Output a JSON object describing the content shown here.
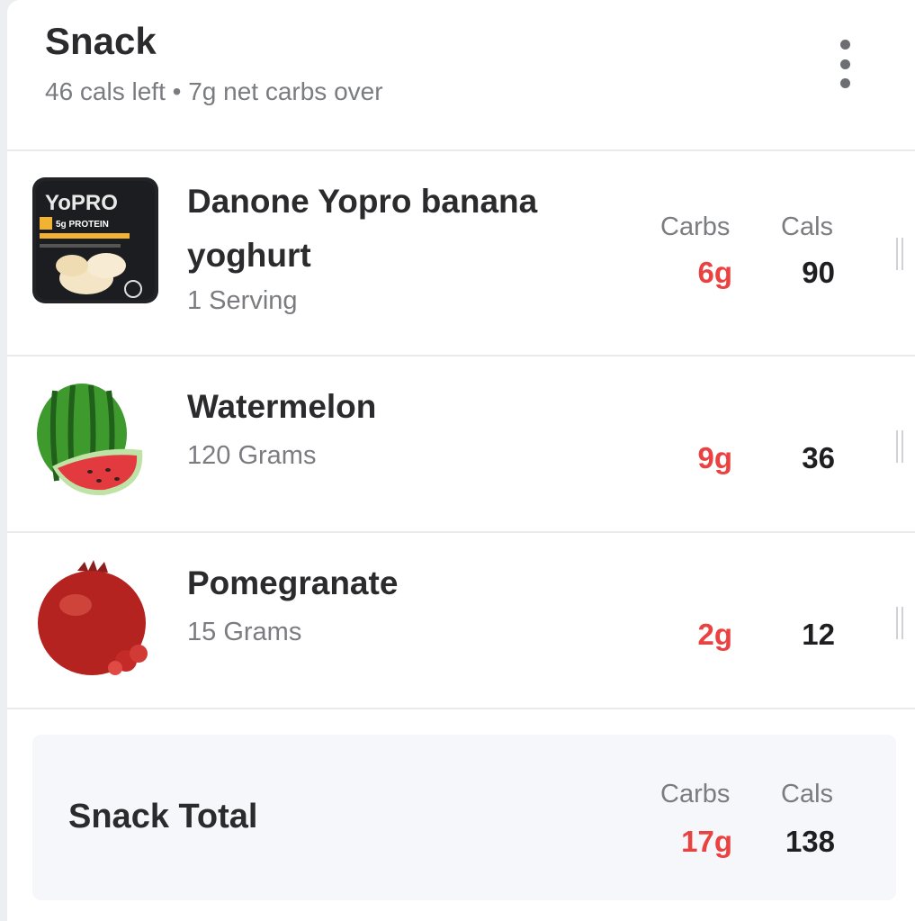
{
  "meal": {
    "title": "Snack",
    "subtitle": "46 cals left • 7g net carbs over"
  },
  "columns": {
    "carbs": "Carbs",
    "cals": "Cals"
  },
  "items": [
    {
      "name": "Danone Yopro banana yoghurt",
      "serving": "1 Serving",
      "carbs": "6g",
      "cals": "90",
      "image": "yopro-yoghurt-pack"
    },
    {
      "name": "Watermelon",
      "serving": "120 Grams",
      "carbs": "9g",
      "cals": "36",
      "image": "watermelon-icon"
    },
    {
      "name": "Pomegranate",
      "serving": "15 Grams",
      "carbs": "2g",
      "cals": "12",
      "image": "pomegranate-icon"
    }
  ],
  "product_label": {
    "brand": "YoPRO",
    "claim": "5g PROTEIN"
  },
  "total": {
    "label": "Snack Total",
    "carbs": "17g",
    "cals": "138"
  },
  "colors": {
    "carbs": "#ea4141",
    "text": "#2b2b2d",
    "muted": "#7b7c80",
    "total_bg": "#f6f7fa"
  }
}
